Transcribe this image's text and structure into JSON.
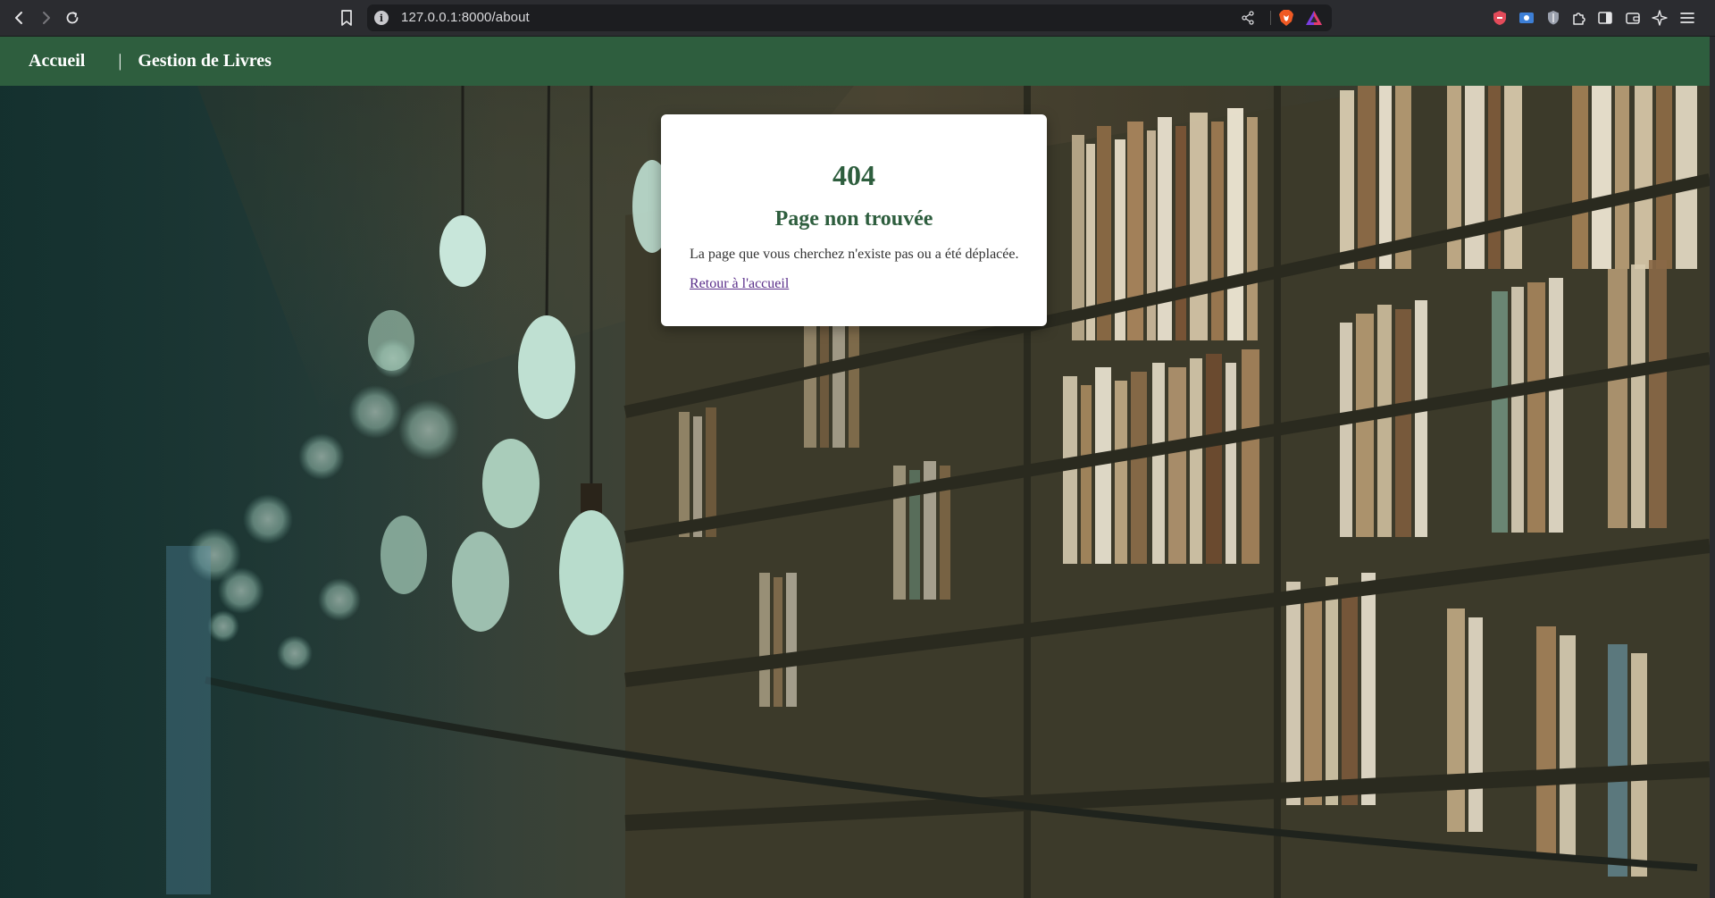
{
  "browser": {
    "url": "127.0.0.1:8000/about",
    "icons": {
      "back": "back-arrow-icon",
      "forward": "forward-arrow-icon",
      "reload": "reload-icon",
      "bookmark": "bookmark-icon",
      "site_info": "info-icon",
      "share": "share-icon",
      "brave_shields": "brave-lion-icon",
      "brave_rewards": "brave-rewards-icon",
      "extensions": [
        "shield-extension-icon",
        "screen-capture-icon",
        "vpn-shield-icon",
        "puzzle-icon",
        "sidebar-icon",
        "wallet-icon",
        "leo-ai-icon",
        "menu-icon"
      ]
    }
  },
  "navbar": {
    "home_label": "Accueil",
    "separator": "|",
    "books_label": "Gestion de Livres"
  },
  "error_card": {
    "code": "404",
    "title": "Page non trouvée",
    "message": "La page que vous cherchez n'existe pas ou a été déplacée.",
    "link_label": "Retour à l'accueil"
  },
  "colors": {
    "navbar_bg": "#2e5e3e",
    "accent_text": "#2e5e3e",
    "link": "#5a2f8a"
  }
}
